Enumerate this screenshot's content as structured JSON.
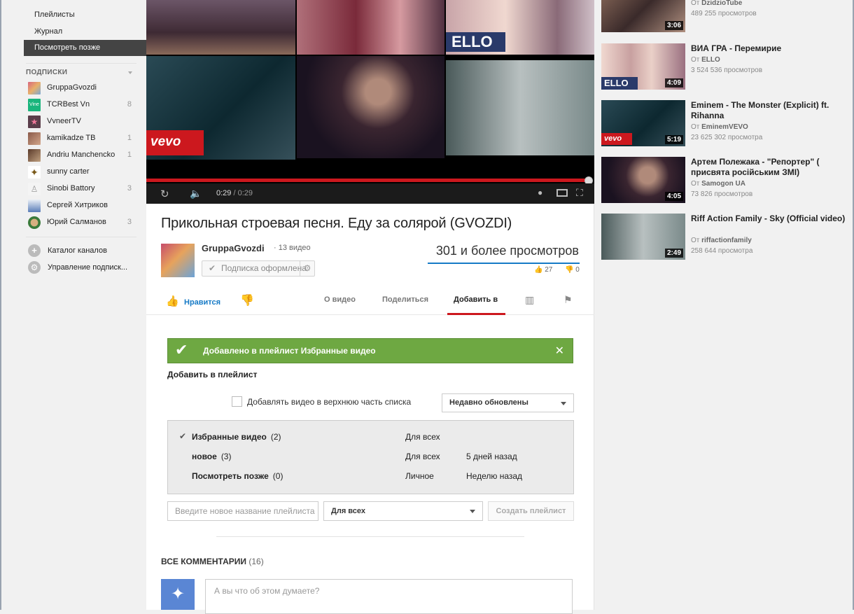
{
  "sidebar": {
    "nav": [
      "Плейлисты",
      "Журнал"
    ],
    "active": "Посмотреть позже",
    "subscriptions_heading": "ПОДПИСКИ",
    "subscriptions": [
      {
        "name": "GruppaGvozdi",
        "count": ""
      },
      {
        "name": "TCRBest Vn",
        "count": "8"
      },
      {
        "name": "VvneerTV",
        "count": ""
      },
      {
        "name": "kamikadze TB",
        "count": "1"
      },
      {
        "name": "Andriu Manchencko",
        "count": "1"
      },
      {
        "name": "sunny carter",
        "count": ""
      },
      {
        "name": "Sinobi Battory",
        "count": "3"
      },
      {
        "name": "Сергей Хитриков",
        "count": ""
      },
      {
        "name": "Юрий Салманов",
        "count": "3"
      }
    ],
    "tools": [
      "Каталог каналов",
      "Управление подписк..."
    ]
  },
  "player": {
    "current_time": "0:29",
    "duration": "/ 0:29",
    "progress": 1.0,
    "tiles": {
      "ello": "ELLO",
      "vevo": "vevo"
    }
  },
  "video": {
    "title": "Прикольная строевая песня. Еду за солярой (GVOZDI)",
    "channel": "GruppaGvozdi",
    "channel_videos": "· 13 видео",
    "subscribe_label": "Подписка оформлена",
    "views": "301 и более просмотров",
    "likes": "27",
    "dislikes": "0"
  },
  "actions": {
    "like": "Нравится",
    "tabs": [
      "О видео",
      "Поделиться",
      "Добавить в"
    ],
    "active_tab": "Добавить в"
  },
  "addto": {
    "notice": "Добавлено в плейлист Избранные видео",
    "heading": "Добавить в плейлист",
    "add_top_label": "Добавлять видео в верхнюю часть списка",
    "sort_value": "Недавно обновлены",
    "playlists": [
      {
        "name": "Избранные видео",
        "count": "(2)",
        "privacy": "Для всех",
        "updated": "",
        "checked": true
      },
      {
        "name": "новое",
        "count": "(3)",
        "privacy": "Для всех",
        "updated": "5 дней назад",
        "checked": false
      },
      {
        "name": "Посмотреть позже",
        "count": "(0)",
        "privacy": "Личное",
        "updated": "Неделю назад",
        "checked": false
      }
    ],
    "new_name_placeholder": "Введите новое название плейлиста",
    "privacy_value": "Для всех",
    "create_label": "Создать плейлист"
  },
  "comments": {
    "heading": "ВСЕ КОММЕНТАРИИ",
    "count": "(16)",
    "placeholder": "А вы что об этом думаете?"
  },
  "related": [
    {
      "title": "",
      "by_prefix": "От",
      "by": "DzidzioTube",
      "views": "489 255 просмотров",
      "duration": "3:06"
    },
    {
      "title": "ВИА ГРА - Перемирие",
      "by_prefix": "От",
      "by": "ELLO",
      "views": "3 524 536 просмотров",
      "duration": "4:09"
    },
    {
      "title": "Eminem - The Monster (Explicit) ft. Rihanna",
      "by_prefix": "От",
      "by": "EminemVEVO",
      "views": "23 625 302 просмотра",
      "duration": "5:19"
    },
    {
      "title": "Артем Полежака - \"Репортер\" ( присвята російським ЗМІ)",
      "by_prefix": "От",
      "by": "Samogon UA",
      "views": "73 826 просмотров",
      "duration": "4:05"
    },
    {
      "title": "Riff Action Family - Sky (Official video)",
      "by_prefix": "От",
      "by": "riffactionfamily",
      "views": "258 644 просмотра",
      "duration": "2:49"
    }
  ],
  "colors": {
    "accent_red": "#cc181e",
    "link_blue": "#167ac6",
    "success_green": "#6ea842",
    "nav_active": "#444444"
  }
}
